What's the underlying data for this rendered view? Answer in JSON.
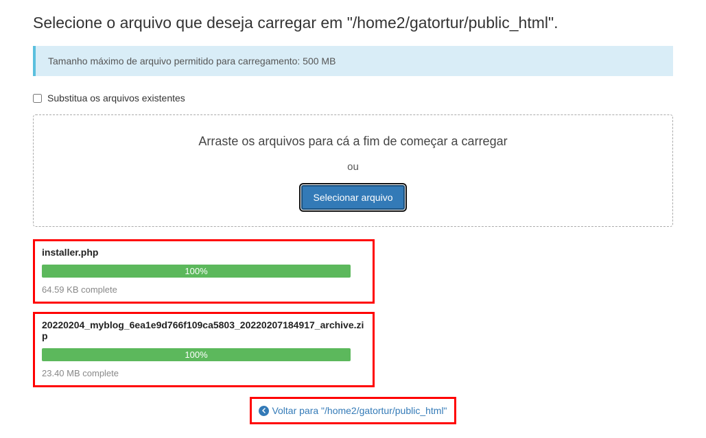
{
  "page_title": "Selecione o arquivo que deseja carregar em \"/home2/gatortur/public_html\".",
  "info_message": "Tamanho máximo de arquivo permitido para carregamento: 500 MB",
  "overwrite_label": "Substitua os arquivos existentes",
  "dropzone": {
    "drag_text": "Arraste os arquivos para cá a fim de começar a carregar",
    "or_text": "ou",
    "button_label": "Selecionar arquivo"
  },
  "uploads": [
    {
      "filename": "installer.php",
      "progress_text": "100%",
      "status": "64.59 KB complete"
    },
    {
      "filename": "20220204_myblog_6ea1e9d766f109ca5803_20220207184917_archive.zip",
      "progress_text": "100%",
      "status": "23.40 MB complete"
    }
  ],
  "back_link_text": "Voltar para \"/home2/gatortur/public_html\""
}
